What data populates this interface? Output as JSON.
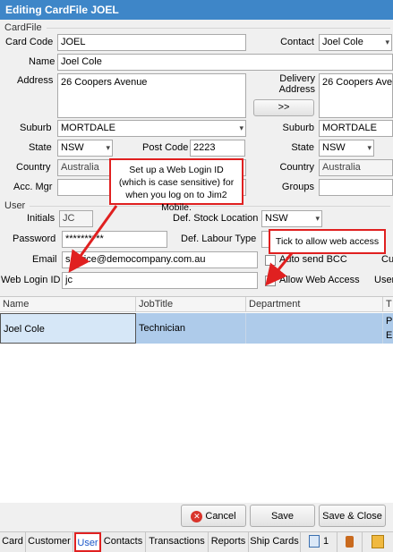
{
  "window": {
    "title": "Editing CardFile JOEL"
  },
  "cardfile": {
    "group_label": "CardFile",
    "card_code_label": "Card Code",
    "card_code": "JOEL",
    "contact_label": "Contact",
    "contact": "Joel Cole",
    "name_label": "Name",
    "name": "Joel Cole",
    "address_label": "Address",
    "address": "26 Coopers Avenue",
    "delivery_label_1": "Delivery",
    "delivery_label_2": "Address",
    "delivery_address": "26 Coopers Aven",
    "copy_button": ">>",
    "suburb_label": "Suburb",
    "suburb": "MORTDALE",
    "delivery_suburb_label": "Suburb",
    "delivery_suburb": "MORTDALE",
    "state_label": "State",
    "state": "NSW",
    "postcode_label": "Post Code",
    "postcode": "2223",
    "delivery_state_label": "State",
    "delivery_state": "NSW",
    "country_label": "Country",
    "country": "Australia",
    "delivery_country_label": "Country",
    "delivery_country": "Australia",
    "acc_mgr_label": "Acc. Mgr",
    "groups_label": "Groups"
  },
  "user": {
    "group_label": "User",
    "initials_label": "Initials",
    "initials": "JC",
    "def_stock_label": "Def. Stock Location",
    "def_stock": "NSW",
    "password_label": "Password",
    "password": "**********",
    "def_labour_label": "Def. Labour Type",
    "email_label": "Email",
    "email": "service@democompany.com.au",
    "auto_bcc_label": "Auto send BCC",
    "cut_label": "Cu",
    "web_login_label": "Web Login ID",
    "web_login": "jc",
    "allow_web_label": "Allow Web Access",
    "user_cut_label": "User"
  },
  "callouts": {
    "web_login_note": "Set up a Web Login ID (which is case sensitive) for when you log on to Jim2 Mobile.",
    "web_access_note": "Tick to allow web access"
  },
  "grid": {
    "columns": [
      "Name",
      "JobTitle",
      "Department",
      "T"
    ],
    "rows": [
      {
        "name": "Joel Cole",
        "job_title": "Technician",
        "department": "",
        "t1": "P",
        "t2": "E"
      }
    ]
  },
  "buttons": {
    "cancel": "Cancel",
    "save": "Save",
    "save_close": "Save & Close"
  },
  "tabs": [
    "Card",
    "Customer",
    "User",
    "Contacts",
    "Transactions",
    "Reports",
    "Ship Cards"
  ],
  "tab_count": "1",
  "colors": {
    "titlebar": "#3e86c8",
    "selected_row": "#aecbea",
    "accent_red": "#e02020",
    "active_tab_border": "#e02020"
  }
}
